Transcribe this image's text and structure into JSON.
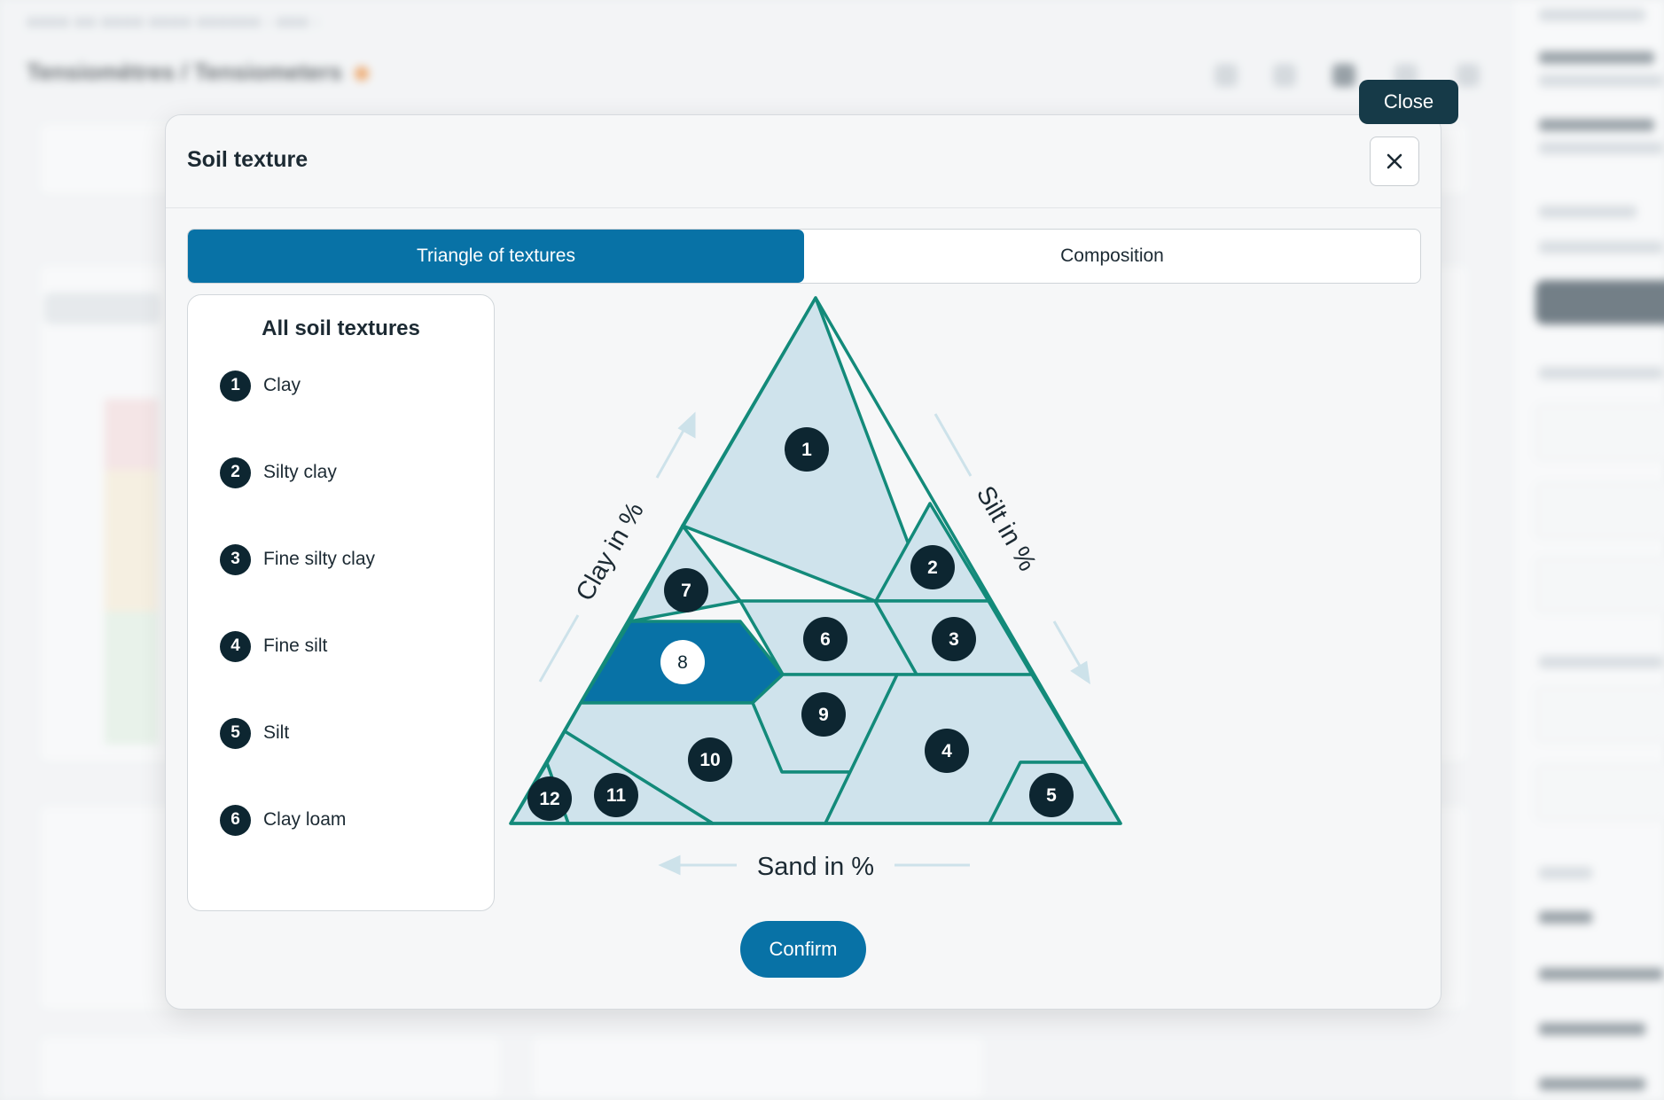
{
  "background": {
    "page_title": "Tensiomètres / Tensiometers"
  },
  "modal": {
    "title": "Soil texture",
    "close_tooltip": "Close",
    "tabs": [
      {
        "label": "Triangle of textures",
        "active": true
      },
      {
        "label": "Composition",
        "active": false
      }
    ],
    "legend": {
      "title": "All soil textures",
      "items": [
        {
          "num": "1",
          "label": "Clay"
        },
        {
          "num": "2",
          "label": "Silty clay"
        },
        {
          "num": "3",
          "label": "Fine silty clay"
        },
        {
          "num": "4",
          "label": "Fine silt"
        },
        {
          "num": "5",
          "label": "Silt"
        },
        {
          "num": "6",
          "label": "Clay loam"
        }
      ]
    },
    "triangle": {
      "axis_clay": "Clay in %",
      "axis_silt": "Silt in %",
      "axis_sand": "Sand in %",
      "selected_region": "8",
      "regions": [
        "1",
        "2",
        "3",
        "4",
        "5",
        "6",
        "7",
        "8",
        "9",
        "10",
        "11",
        "12"
      ]
    },
    "confirm_label": "Confirm"
  },
  "colors": {
    "primary": "#0872a6",
    "region_fill": "#cfe3ec",
    "region_stroke": "#138a7a",
    "badge": "#0d2631"
  }
}
